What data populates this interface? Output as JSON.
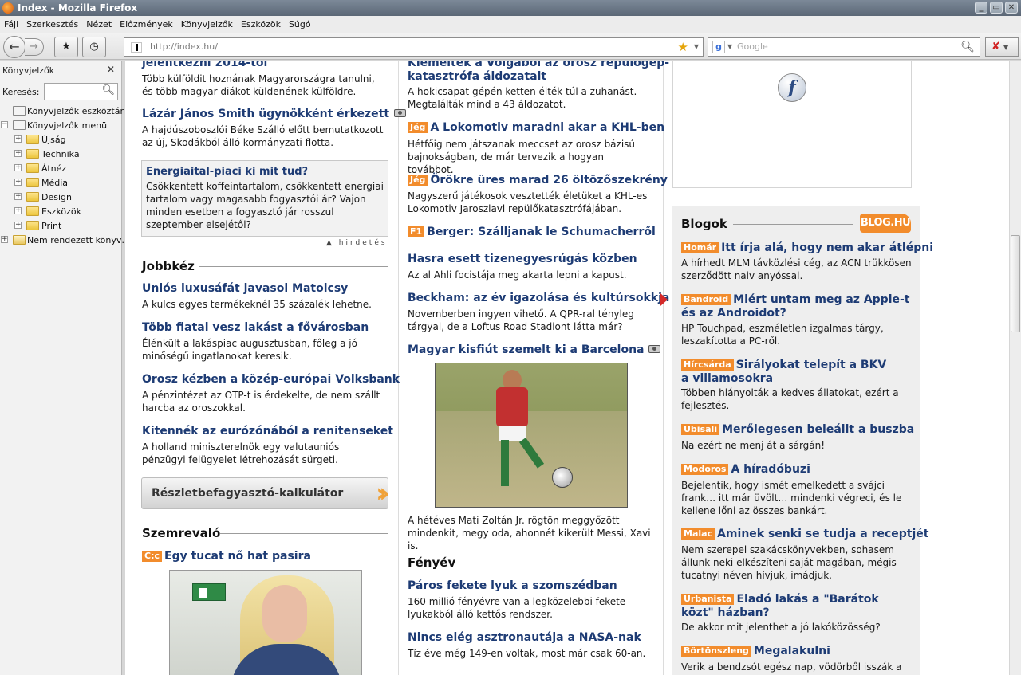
{
  "window": {
    "title": "Index - Mozilla Firefox",
    "controls": [
      "_",
      "▭",
      "✕"
    ]
  },
  "menu": [
    "Fájl",
    "Szerkesztés",
    "Nézet",
    "Előzmények",
    "Könyvjelzők",
    "Eszközök",
    "Súgó"
  ],
  "navbar": {
    "url": "http://index.hu/",
    "search_placeholder": "Google"
  },
  "sidebar": {
    "title": "Könyvjelzők",
    "search_label": "Keresés:",
    "items": [
      {
        "label": "Könyvjelzők eszköztár",
        "kind": "toolbar"
      },
      {
        "label": "Könyvjelzők menü",
        "kind": "menu",
        "expanded": true
      },
      {
        "label": "Újság",
        "kind": "folder"
      },
      {
        "label": "Technika",
        "kind": "folder"
      },
      {
        "label": "Átnéz",
        "kind": "folder"
      },
      {
        "label": "Média",
        "kind": "folder"
      },
      {
        "label": "Design",
        "kind": "folder"
      },
      {
        "label": "Eszközök",
        "kind": "folder"
      },
      {
        "label": "Print",
        "kind": "folder"
      },
      {
        "label": "Nem rendezett könyv…",
        "kind": "unsorted"
      }
    ]
  },
  "col1": {
    "top_headline": "jelentkezni 2014-től",
    "top_text": "Több külföldit hoznának Magyarországra tanulni, és több magyar diákot küldenének külföldre.",
    "smith_headline": "Lázár János Smith ügynökként érkezett",
    "smith_text": "A hajdúszoboszlói Béke Szálló előtt bemutatkozott az új, Skodákból álló kormányzati flotta.",
    "ad_headline": "Energiaital-piaci ki mit tud?",
    "ad_text": "Csökkentett koffeintartalom, csökkentett energiai tartalom vagy magasabb fogyasztói ár? Vajon minden esetben a fogyasztó jár rosszul szeptember elsejétől?",
    "ad_note": "hirdetés",
    "section_jobbkez": "Jobbkéz",
    "j1_headline": "Uniós luxusáfát javasol Matolcsy",
    "j1_text": "A kulcs egyes termékeknél 35 százalék lehetne.",
    "j2_headline": "Több fiatal vesz lakást a fővárosban",
    "j2_text": "Élénkült a lakáspiac augusztusban, főleg a jó minőségű ingatlanokat keresik.",
    "j3_headline": "Orosz kézben a közép-európai Volksbank",
    "j3_text": "A pénzintézet az OTP-t is érdekelte, de nem szállt harcba az oroszokkal.",
    "j4_headline": "Kitennék az eurózónából a renitenseket",
    "j4_text": "A holland miniszterelnök egy valutauniós pénzügyi felügyelet létrehozását sürgeti.",
    "calc_label": "Részletbefagyasztó-kalkulátor",
    "section_szemrevalo": "Szemrevaló",
    "cc_tag": "C:c",
    "cc_headline": "Egy tucat nő hat pasira"
  },
  "col2": {
    "top_headline_1": "Kiemelték a Volgából az orosz repülőgép-",
    "top_headline_2": "katasztrófa áldozatait",
    "top_text": "A hokicsapat gépén ketten élték túl a zuhanást. Megtalálták mind a 43 áldozatot.",
    "a1_tag": "Jég",
    "a1_headline": "A Lokomotiv maradni akar a KHL-ben",
    "a1_text": "Hétfőig nem játszanak meccset az orosz bázisú bajnokságban, de már tervezik a hogyan továbbot.",
    "a2_tag": "Jég",
    "a2_headline": "Örökre üres marad 26 öltözőszekrény",
    "a2_text": "Nagyszerű játékosok vesztették életüket a KHL-es Lokomotiv Jaroszlavl repülőkatasztrófájában.",
    "a3_tag": "F1",
    "a3_headline": "Berger: Szálljanak le Schumacherről",
    "a4_headline": "Hasra esett tizenegyesrúgás közben",
    "a4_text": "Az al Ahli focistája meg akarta lepni a kapust.",
    "a5_headline": "Beckham: az év igazolása és kultúrsokkja",
    "a5_text": "Novemberben ingyen vihető. A QPR-ral tényleg tárgyal, de a Loftus Road Stadiont látta már?",
    "a6_headline": "Magyar kisfiút szemelt ki a Barcelona",
    "a6_text": "A hétéves Mati Zoltán Jr. rögtön meggyőzött mindenkit, megy oda, ahonnét kikerült Messi, Xavi is.",
    "section_fenyev": "Fényév",
    "f1_headline": "Páros fekete lyuk a szomszédban",
    "f1_text": "160 millió fényévre van a legközelebbi fekete lyukakból álló kettős rendszer.",
    "f2_headline": "Nincs elég asztronautája a NASA-nak",
    "f2_text": "Tíz éve még 149-en voltak, most már csak 60-an."
  },
  "col3": {
    "flash_icon": "flash-player-icon",
    "blog_title": "Blogok",
    "blog_logo": "BLOG.HU",
    "posts": [
      {
        "tag": "Homár",
        "headline": "Itt írja alá, hogy nem akar átlépni",
        "text": "A hírhedt MLM távközlési cég, az ACN trükkösen szerződött naiv anyóssal."
      },
      {
        "tag": "Bandroid",
        "headline": "Miért untam meg az Apple-t és az Androidot?",
        "text": "HP Touchpad, eszméletlen izgalmas tárgy, leszakította a PC-ről."
      },
      {
        "tag": "Hírcsárda",
        "headline": "Sirályokat telepít a BKV a villamosokra",
        "text": "Többen hiányolták a kedves állatokat, ezért a fejlesztés."
      },
      {
        "tag": "Ubisali",
        "headline": "Merőlegesen beleállt a buszba",
        "text": "Na ezért ne menj át a sárgán!"
      },
      {
        "tag": "Modoros",
        "headline": "A híradóbuzi",
        "text": "Bejelentik, hogy ismét emelkedett a svájci frank… itt már üvölt… mindenki végreci, és le kellene lőni az összes bankárt."
      },
      {
        "tag": "Malac",
        "headline": "Aminek senki se tudja a receptjét",
        "text": "Nem szerepel szakácskönyvekben, sohasem állunk neki elkészíteni saját magában, mégis tucatnyi néven hívjuk, imádjuk."
      },
      {
        "tag": "Urbanista",
        "headline": "Eladó lakás a \"Barátok közt\" házban?",
        "text": "De akkor mit jelenthet a jó lakóközösség?"
      },
      {
        "tag": "Börtönszleng",
        "headline": "Megalakulni",
        "text": "Verik a bendzsót egész nap, vödörből isszák a"
      }
    ]
  }
}
